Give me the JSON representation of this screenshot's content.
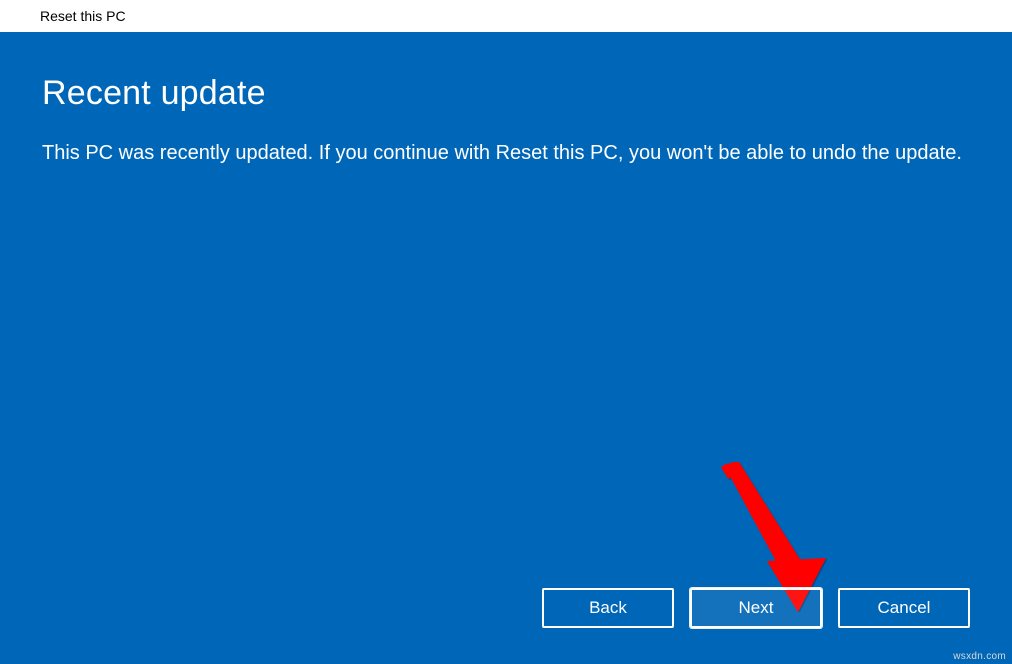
{
  "window": {
    "title": "Reset this PC"
  },
  "dialog": {
    "heading": "Recent update",
    "body": "This PC was recently updated. If you continue with Reset this PC, you won't be able to undo the update."
  },
  "buttons": {
    "back": "Back",
    "next": "Next",
    "cancel": "Cancel"
  },
  "annotation": {
    "target": "next-button",
    "arrow_color": "#ff0000"
  },
  "watermark": "wsxdn.com"
}
